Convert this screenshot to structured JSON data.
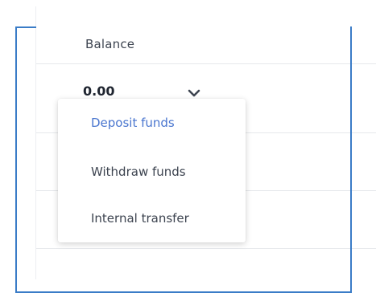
{
  "table": {
    "header": {
      "balance_label": "Balance"
    },
    "row": {
      "amount": "0.00"
    }
  },
  "menu": {
    "items": [
      {
        "label": "Deposit funds",
        "active": true
      },
      {
        "label": "Withdraw funds",
        "active": false
      },
      {
        "label": "Internal transfer",
        "active": false
      }
    ]
  },
  "colors": {
    "accent": "#4a76cf",
    "outline": "#3a7cc7",
    "text": "#3d4450"
  },
  "icons": {
    "toggle": "chevron-down-icon"
  }
}
